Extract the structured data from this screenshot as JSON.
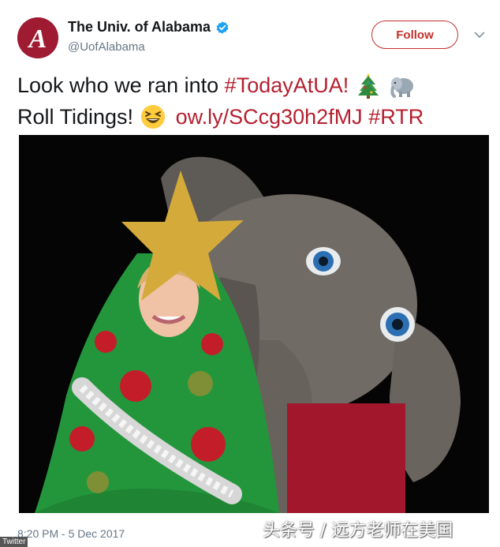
{
  "account": {
    "display_name": "The Univ. of Alabama",
    "handle": "@UofAlabama",
    "verified": true,
    "avatar_letter": "A"
  },
  "follow_label": "Follow",
  "tweet": {
    "line1_text": "Look who we ran into ",
    "line1_hashtag": "#TodayAtUA!",
    "line2_text": "Roll Tidings! ",
    "line2_link": "ow.ly/SCcg30h2fMJ",
    "line2_hashtag": "#RTR",
    "emojis": [
      "christmas-tree",
      "elephant",
      "grinning-squinting-face"
    ]
  },
  "timestamp": "8:20 PM - 5 Dec 2017",
  "watermark_left": "Twitter",
  "watermark_right": "头条号 / 远方老师在美国",
  "colors": {
    "brand_crimson": "#9e1b32",
    "link": "#b5202f",
    "follow_border": "#c4302b",
    "verified_blue": "#1da1f2",
    "muted_text": "#657786"
  }
}
